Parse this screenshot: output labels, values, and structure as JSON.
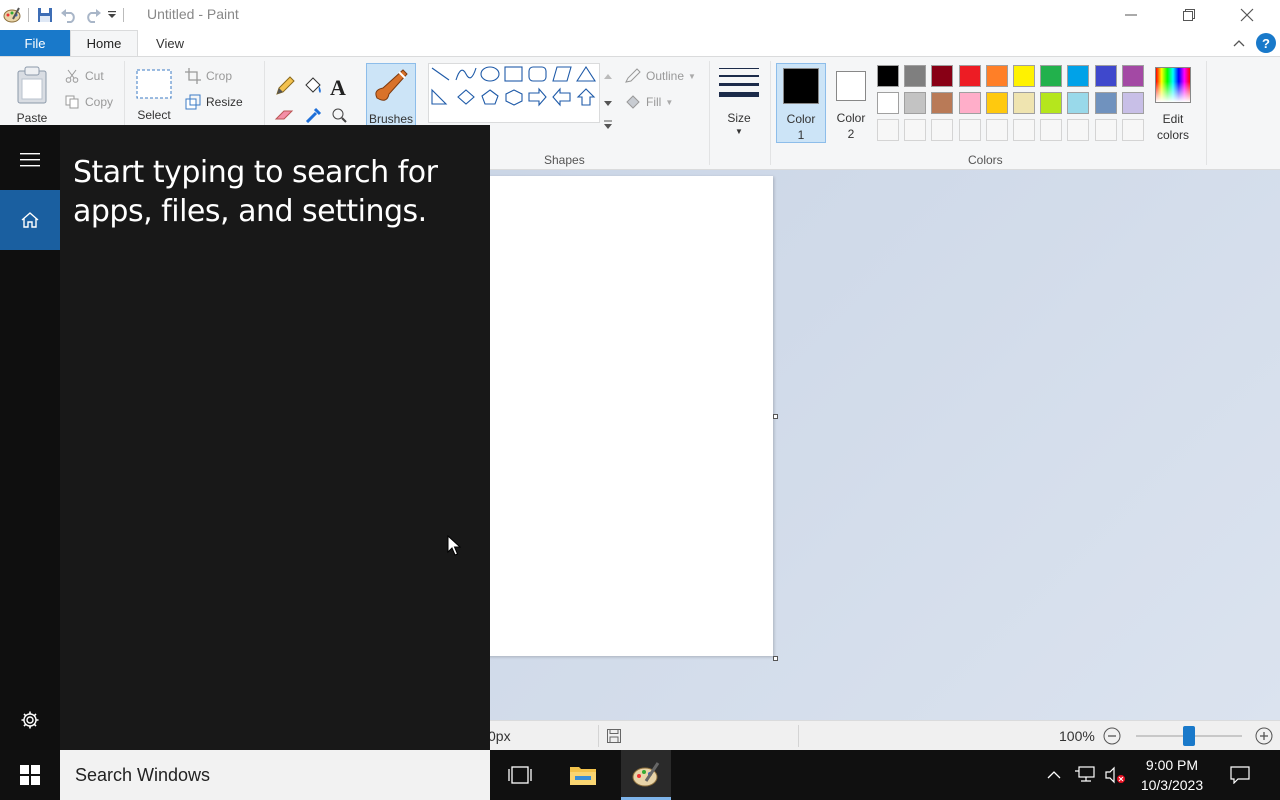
{
  "window": {
    "title": "Untitled - Paint"
  },
  "tabs": {
    "file": "File",
    "home": "Home",
    "view": "View"
  },
  "ribbon": {
    "clipboard": {
      "paste": "Paste",
      "cut": "Cut",
      "copy": "Copy"
    },
    "image": {
      "select": "Select",
      "crop": "Crop",
      "resize": "Resize"
    },
    "tools": {
      "brushes": "Brushes"
    },
    "shapes": {
      "label": "Shapes",
      "outline": "Outline",
      "fill": "Fill"
    },
    "size": {
      "label": "Size"
    },
    "colors": {
      "color1_label_line1": "Color",
      "color1_label_line2": "1",
      "color2_label_line1": "Color",
      "color2_label_line2": "2",
      "edit_line1": "Edit",
      "edit_line2": "colors",
      "label": "Colors",
      "color1": "#000000",
      "color2": "#ffffff",
      "palette_row1": [
        "#000000",
        "#7f7f7f",
        "#880015",
        "#ed1c24",
        "#ff7f27",
        "#fff200",
        "#22b14c",
        "#00a2e8",
        "#3f48cc",
        "#a349a4"
      ],
      "palette_row2": [
        "#ffffff",
        "#c3c3c3",
        "#b97a57",
        "#ffaec9",
        "#ffc90e",
        "#efe4b0",
        "#b5e61d",
        "#99d9ea",
        "#7092be",
        "#c8bfe7"
      ]
    }
  },
  "statusbar": {
    "size_fragment": "0px",
    "zoom": "100%"
  },
  "start": {
    "hint": "Start typing to search for apps, files, and settings.",
    "search_placeholder": "Search Windows"
  },
  "taskbar": {
    "time": "9:00 PM",
    "date": "10/3/2023"
  }
}
